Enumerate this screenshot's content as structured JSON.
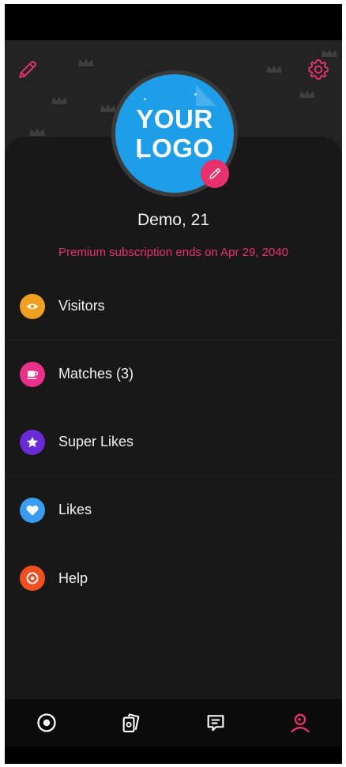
{
  "header": {
    "edit_icon": "pencil-icon",
    "settings_icon": "gear-icon",
    "accent_color": "#e6336f"
  },
  "profile": {
    "logo_line1": "YOUR",
    "logo_line2": "LOGO",
    "name_age": "Demo, 21",
    "subscription_text": "Premium subscription ends on Apr 29, 2040",
    "avatar_edit_icon": "pencil-icon"
  },
  "menu": {
    "items": [
      {
        "label": "Visitors",
        "icon": "eye-icon",
        "color": "#f0a020"
      },
      {
        "label": "Matches (3)",
        "icon": "cup-icon",
        "color": "#e8318a"
      },
      {
        "label": "Super Likes",
        "icon": "star-icon",
        "color": "#6a2bd6"
      },
      {
        "label": "Likes",
        "icon": "heart-icon",
        "color": "#3a9cf0"
      },
      {
        "label": "Help",
        "icon": "lifebuoy-icon",
        "color": "#f05020"
      }
    ]
  },
  "bottom_nav": {
    "items": [
      {
        "name": "discover",
        "icon": "target-icon",
        "active": false
      },
      {
        "name": "cards",
        "icon": "cards-icon",
        "active": false
      },
      {
        "name": "chat",
        "icon": "chat-icon",
        "active": false
      },
      {
        "name": "profile",
        "icon": "profile-icon",
        "active": true
      }
    ],
    "active_color": "#e6336f",
    "inactive_color": "#ffffff"
  }
}
